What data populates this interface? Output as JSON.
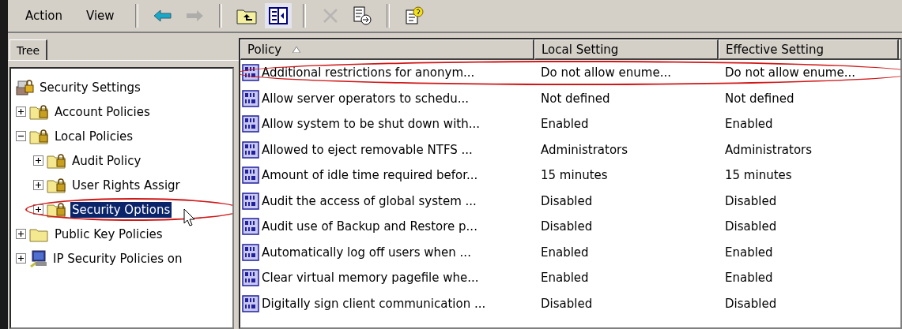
{
  "menu": [
    {
      "label": "Action"
    },
    {
      "label": "View"
    }
  ],
  "toolbar": [
    {
      "kind": "back",
      "disabled": false
    },
    {
      "kind": "forward",
      "disabled": true
    },
    {
      "kind": "sep"
    },
    {
      "kind": "up",
      "disabled": false
    },
    {
      "kind": "tree",
      "disabled": false
    },
    {
      "kind": "sep"
    },
    {
      "kind": "delete",
      "disabled": true
    },
    {
      "kind": "export",
      "disabled": false
    },
    {
      "kind": "sep"
    },
    {
      "kind": "help",
      "disabled": false
    }
  ],
  "tree_tab": {
    "label": "Tree"
  },
  "tree": [
    {
      "label": "Security Settings",
      "kind": "root",
      "selected": false,
      "circled": false,
      "children": [
        {
          "label": "Account Policies",
          "kind": "folder",
          "expanded": false,
          "selected": false,
          "circled": false
        },
        {
          "label": "Local Policies",
          "kind": "folder",
          "expanded": true,
          "selected": false,
          "circled": false,
          "children": [
            {
              "label": "Audit Policy",
              "kind": "folder",
              "expanded": false,
              "selected": false,
              "circled": false
            },
            {
              "label": "User Rights Assigr",
              "kind": "folder",
              "expanded": false,
              "selected": false,
              "circled": false
            },
            {
              "label": "Security Options",
              "kind": "folder",
              "expanded": false,
              "selected": true,
              "circled": true
            }
          ]
        },
        {
          "label": "Public Key Policies",
          "kind": "plainfolder",
          "expanded": false,
          "selected": false,
          "circled": false
        },
        {
          "label": "IP Security Policies on",
          "kind": "computer",
          "expanded": false,
          "selected": false,
          "circled": false
        }
      ]
    }
  ],
  "table": {
    "columns": [
      {
        "label": "Policy",
        "sorted": true
      },
      {
        "label": "Local Setting",
        "sorted": false
      },
      {
        "label": "Effective Setting",
        "sorted": false
      }
    ],
    "rows": [
      {
        "policy": "Additional restrictions for anonym...",
        "local": "Do not allow enume...",
        "effective": "Do not allow enume...",
        "circled": true
      },
      {
        "policy": "Allow server operators to schedu...",
        "local": "Not defined",
        "effective": "Not defined",
        "circled": false
      },
      {
        "policy": "Allow system to be shut down with...",
        "local": "Enabled",
        "effective": "Enabled",
        "circled": false
      },
      {
        "policy": "Allowed to eject removable NTFS ...",
        "local": "Administrators",
        "effective": "Administrators",
        "circled": false
      },
      {
        "policy": "Amount of idle time required befor...",
        "local": "15 minutes",
        "effective": "15 minutes",
        "circled": false
      },
      {
        "policy": "Audit the access of global system ...",
        "local": "Disabled",
        "effective": "Disabled",
        "circled": false
      },
      {
        "policy": "Audit use of Backup and Restore p...",
        "local": "Disabled",
        "effective": "Disabled",
        "circled": false
      },
      {
        "policy": "Automatically log off users when ...",
        "local": "Enabled",
        "effective": "Enabled",
        "circled": false
      },
      {
        "policy": "Clear virtual memory pagefile whe...",
        "local": "Enabled",
        "effective": "Enabled",
        "circled": false
      },
      {
        "policy": "Digitally sign client communication ...",
        "local": "Disabled",
        "effective": "Disabled",
        "circled": false
      }
    ]
  }
}
